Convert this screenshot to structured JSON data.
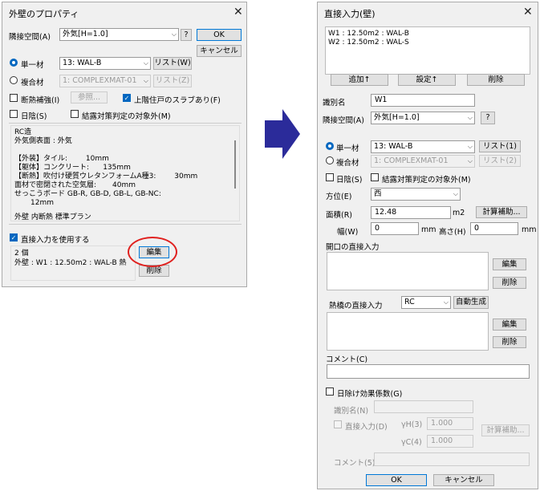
{
  "left": {
    "title": "外壁のプロパティ",
    "adj_label": "隣接空間(A)",
    "adj_value": "外気[H=1.0]",
    "help": "?",
    "ok": "OK",
    "cancel": "キャンセル",
    "single_label": "単一材",
    "single_value": "13: WAL-B",
    "list_w": "リスト(W)",
    "composite_label": "複合材",
    "composite_value": "1: COMPLEXMAT-01",
    "list_z": "リスト(Z)",
    "insul_label": "断熱補強(I)",
    "ref_button": "参照...",
    "upper_slab_label": "上階住戸のスラブあり(F)",
    "shade_label": "日陰(S)",
    "dew_label": "結露対策判定の対象外(M)",
    "info_lines": [
      "RC造",
      "外気側表面 : 外気",
      "",
      "【外装】タイル:        10mm",
      "【躯体】コンクリート:      135mm",
      "【断熱】吹付け硬質ウレタンフォームA種3:        30mm",
      "面材で密閉された空気層:       40mm",
      "せっこうボード GB-R, GB-D, GB-L, GB-NC:",
      "       12mm"
    ],
    "info_bottom": "外壁 内断熱 標準プラン",
    "direct_label": "直接入力を使用する",
    "direct_count": "2 個",
    "direct_summary": "外壁 : W1 : 12.50m2 : WAL-B 熱",
    "edit": "編集",
    "delete": "削除"
  },
  "right": {
    "title": "直接入力(壁)",
    "entries": [
      "W1 : 12.50m2 : WAL-B",
      "W2 : 12.50m2 : WAL-S"
    ],
    "add": "追加↑",
    "set": "設定↑",
    "del": "削除",
    "id_label": "識別名",
    "id_value": "W1",
    "adj_label": "隣接空間(A)",
    "adj_value": "外気[H=1.0]",
    "help": "?",
    "single_label": "単一材",
    "single_value": "13: WAL-B",
    "list_1": "リスト(1)",
    "composite_label": "複合材",
    "composite_value": "1: COMPLEXMAT-01",
    "list_2": "リスト(2)",
    "shade_label": "日陰(S)",
    "dew_label": "結露対策判定の対象外(M)",
    "dir_label": "方位(E)",
    "dir_value": "西",
    "area_label": "面積(R)",
    "area_value": "12.48",
    "area_unit": "m2",
    "calc_aux": "計算補助...",
    "width_label": "幅(W)",
    "width_value": "0",
    "width_unit": "mm",
    "height_label": "高さ(H)",
    "height_value": "0",
    "height_unit": "mm",
    "opening_label": "開口の直接入力",
    "op_edit": "編集",
    "op_del": "削除",
    "thermal_label": "熱橋の直接入力",
    "thermal_value": "RC",
    "auto_gen": "自動生成",
    "th_edit": "編集",
    "th_del": "削除",
    "comment_label": "コメント(C)",
    "shade_coef_label": "日除け効果係数(G)",
    "sc_id_label": "識別名(N)",
    "sc_direct_label": "直接入力(D)",
    "yh_label": "γH(3)",
    "yh_value": "1.000",
    "yc_label": "γC(4)",
    "yc_value": "1.000",
    "sc_calc": "計算補助...",
    "sc_comment_label": "コメント(5)",
    "ok": "OK",
    "cancel": "キャンセル"
  },
  "colors": {
    "accent": "#0067c0",
    "highlight_circle": "#e0201e",
    "arrow": "#2b2b9a"
  }
}
